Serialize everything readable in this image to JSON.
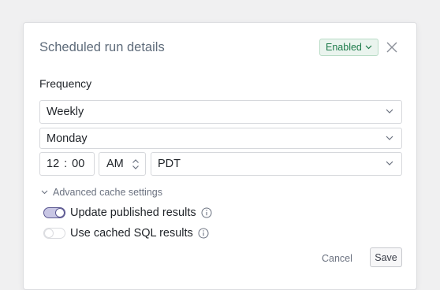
{
  "dialog": {
    "title": "Scheduled run details",
    "status": {
      "label": "Enabled",
      "color": "#1d7a4a",
      "background": "#eaf4ee"
    },
    "close_icon": "close-icon"
  },
  "frequency": {
    "label": "Frequency",
    "interval": "Weekly",
    "day": "Monday",
    "hour": "12",
    "separator": ":",
    "minute": "00",
    "meridiem": "AM",
    "timezone": "PDT"
  },
  "advanced": {
    "label": "Advanced cache settings",
    "options": [
      {
        "label": "Update published results",
        "enabled": true
      },
      {
        "label": "Use cached SQL results",
        "enabled": false
      }
    ]
  },
  "actions": {
    "cancel": "Cancel",
    "save": "Save"
  },
  "colors": {
    "toggle_on": "#5b5891",
    "toggle_on_track": "#c8c6e4"
  }
}
